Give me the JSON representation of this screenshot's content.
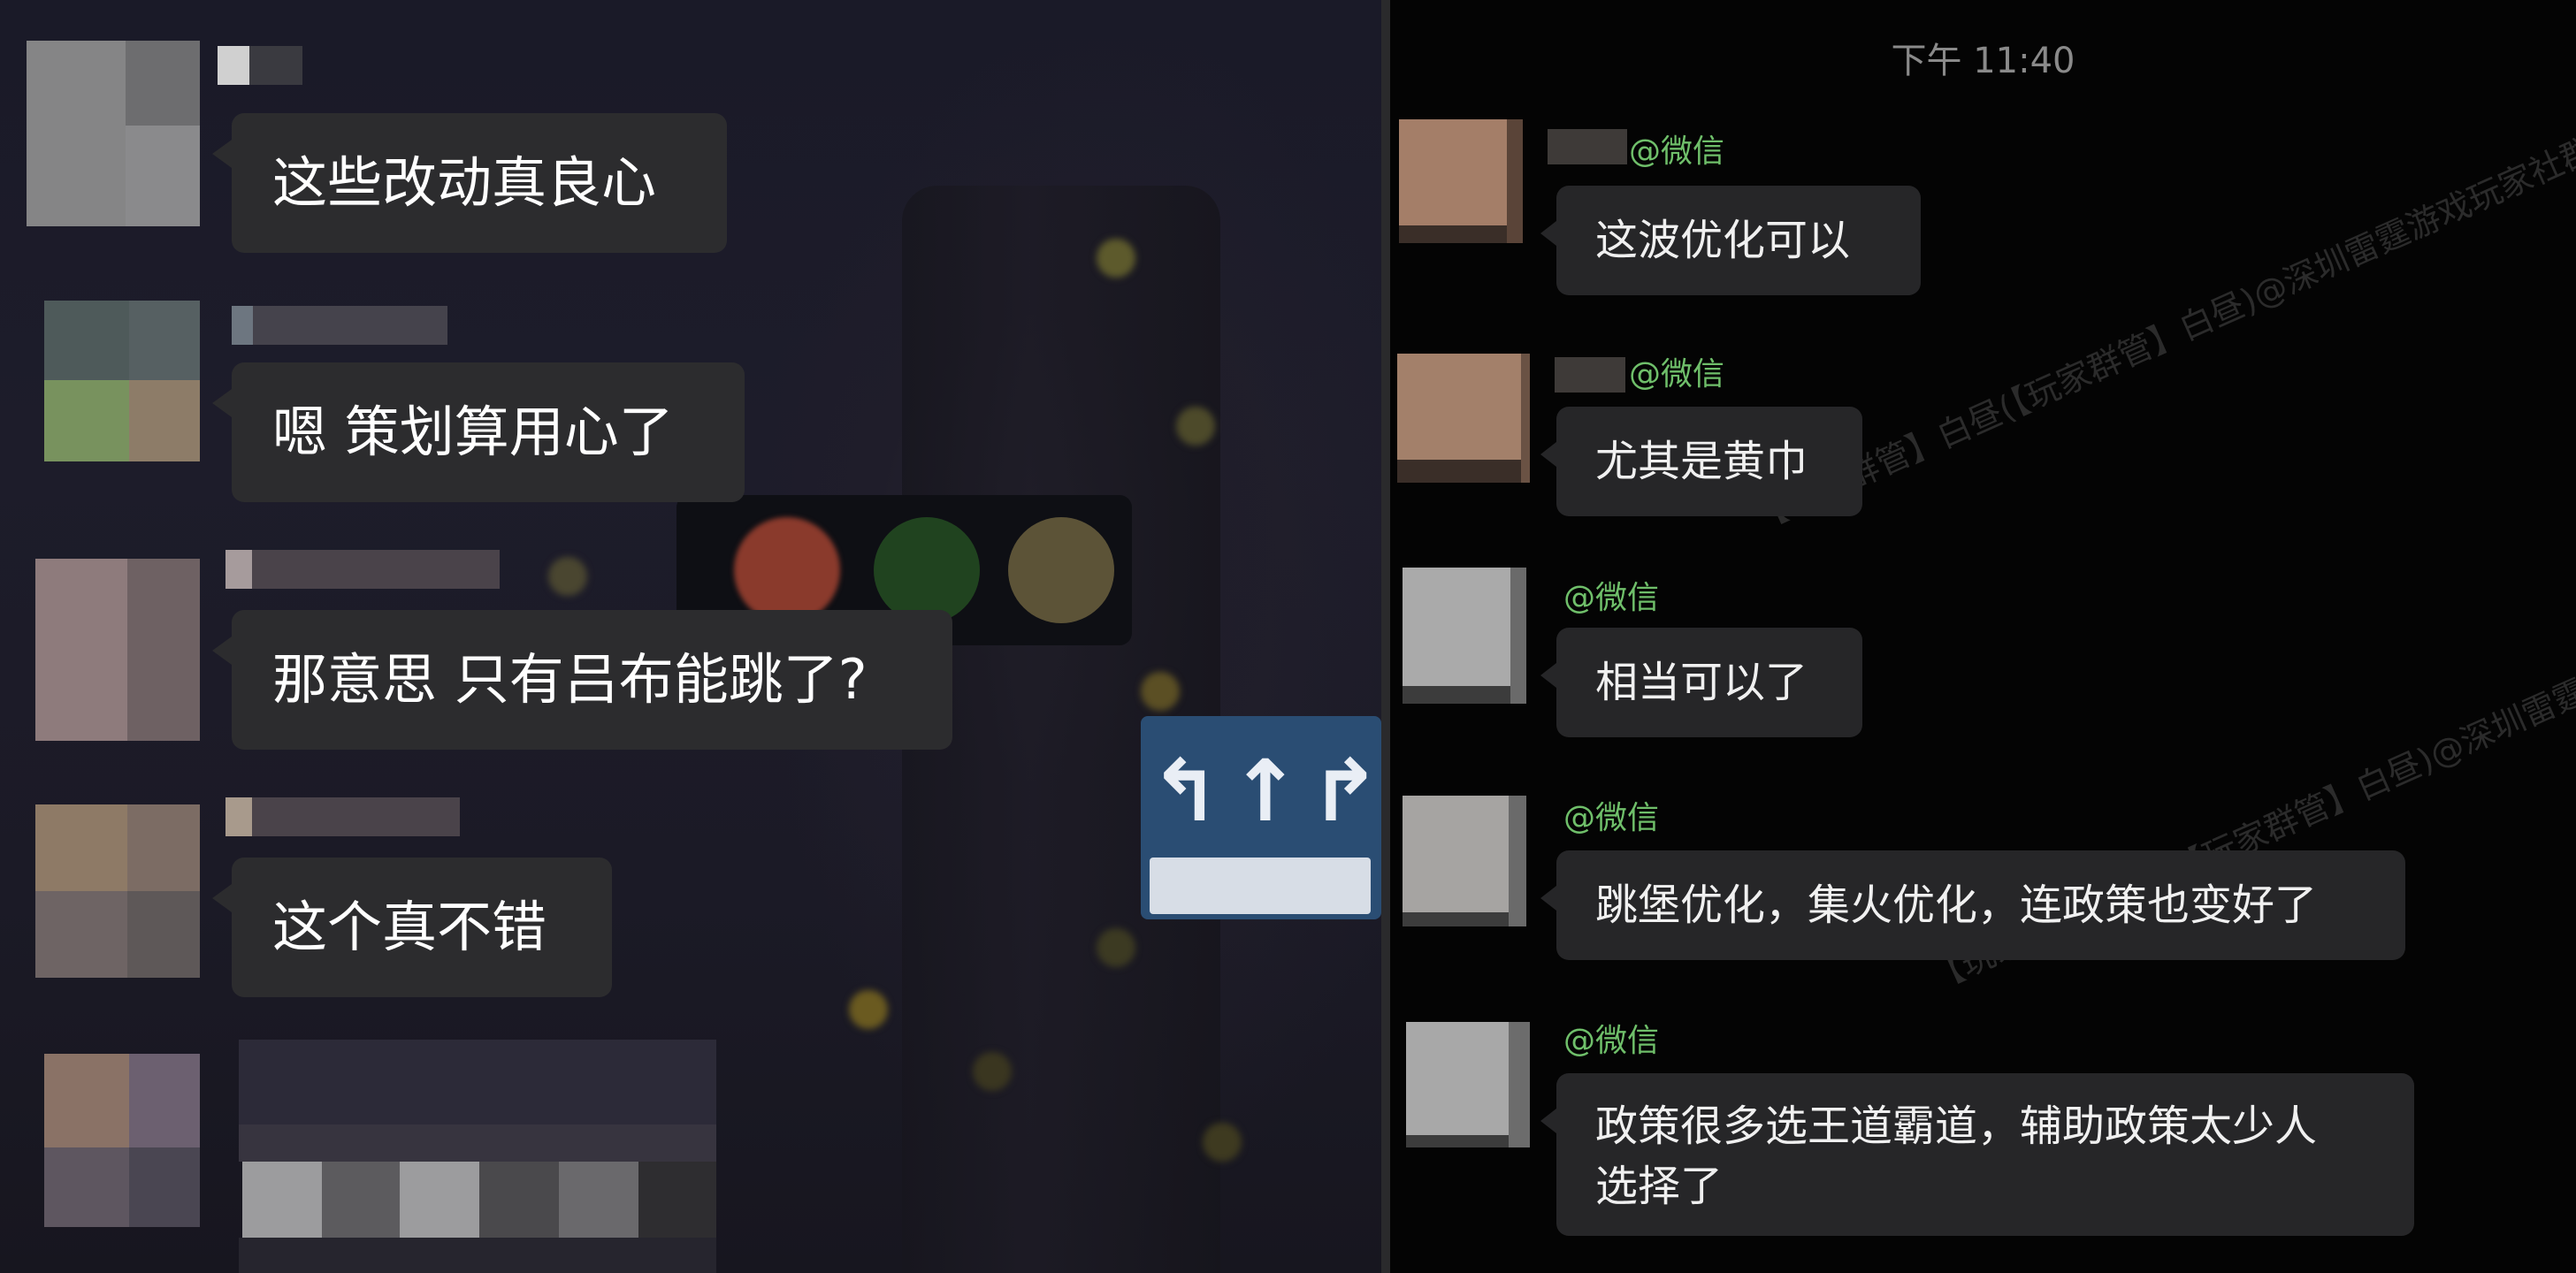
{
  "left_chat": {
    "messages": [
      {
        "text": "这些改动真良心"
      },
      {
        "text": "嗯 策划算用心了"
      },
      {
        "text": "那意思 只有吕布能跳了?"
      },
      {
        "text": "这个真不错"
      }
    ]
  },
  "right_chat": {
    "timestamp": "下午 11:40",
    "messages": [
      {
        "sender_suffix": "@微信",
        "text": "这波优化可以"
      },
      {
        "sender_suffix": "@微信",
        "text": "尤其是黄巾"
      },
      {
        "sender_suffix": "@微信",
        "text": "相当可以了"
      },
      {
        "sender_suffix": "@微信",
        "text": "跳堡优化，集火优化，连政策也变好了"
      },
      {
        "sender_suffix": "@微信",
        "text": "政策很多选王道霸道，辅助政策太少人选择了"
      }
    ],
    "watermark": "【玩家群管】白昼(【玩家群管】白昼)@深圳雷霆游戏玩家社群"
  },
  "colors": {
    "bubble_left": "#2c2c2e",
    "bubble_right": "#262628",
    "sender_name": "#6fbf6a",
    "timestamp": "#8a8a8a"
  }
}
